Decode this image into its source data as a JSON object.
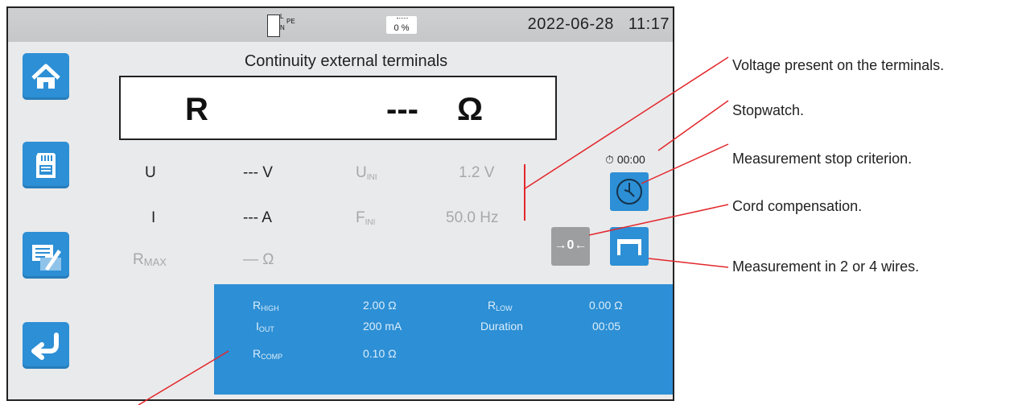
{
  "status_bar": {
    "terminal_labels": {
      "top": "L",
      "mid": "N",
      "pe": "PE"
    },
    "battery_level": "0 %",
    "date": "2022-06-28",
    "time": "11:17"
  },
  "sidebar": {
    "buttons": [
      {
        "name": "home",
        "icon": "home-icon"
      },
      {
        "name": "memory",
        "icon": "sd-card-icon"
      },
      {
        "name": "settings",
        "icon": "edit-icon"
      },
      {
        "name": "back",
        "icon": "return-arrow-icon"
      }
    ]
  },
  "measurement": {
    "title": "Continuity external terminals",
    "main_symbol": "R",
    "main_value": "---",
    "main_unit": "Ω",
    "rows": [
      {
        "label": "U",
        "value": "--- V",
        "ref_label": "U",
        "ref_sub": "INI",
        "ref_value": "1.2 V"
      },
      {
        "label": "I",
        "value": "--- A",
        "ref_label": "F",
        "ref_sub": "INI",
        "ref_value": "50.0 Hz"
      },
      {
        "label": "R",
        "label_sub": "MAX",
        "value": "— Ω"
      }
    ]
  },
  "controls": {
    "stopwatch": "00:00",
    "cord_compensation_label": "→0←"
  },
  "parameters": {
    "r_high_label": "R",
    "r_high_sub": "HIGH",
    "r_high_value": "2.00 Ω",
    "r_low_label": "R",
    "r_low_sub": "LOW",
    "r_low_value": "0.00 Ω",
    "i_out_label": "I",
    "i_out_sub": "OUT",
    "i_out_value": "200 mA",
    "duration_label": "Duration",
    "duration_value": "00:05",
    "r_comp_label": "R",
    "r_comp_sub": "COMP",
    "r_comp_value": "0.10 Ω"
  },
  "annotations": [
    "Voltage present on the terminals.",
    "Stopwatch.",
    "Measurement stop criterion.",
    "Cord compensation.",
    "Measurement in 2 or 4 wires."
  ],
  "colors": {
    "accent_blue": "#2d8fd5",
    "leader_red": "#e2272c",
    "screen_bg": "#e9eaeb"
  }
}
